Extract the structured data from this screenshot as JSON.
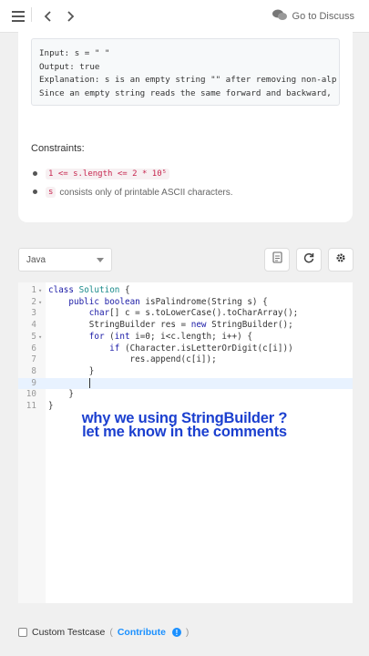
{
  "header": {
    "discuss_label": "Go to Discuss"
  },
  "description": {
    "example_lines": [
      "Input: s = \" \"",
      "Output: true",
      "Explanation: s is an empty string \"\" after removing non-alp",
      "Since an empty string reads the same forward and backward,"
    ],
    "constraints_title": "Constraints:",
    "constraints": [
      {
        "code": "1 <= s.length <= 2 * 10⁵",
        "text": ""
      },
      {
        "code": "s",
        "text": "consists only of printable ASCII characters."
      }
    ]
  },
  "editor": {
    "language": "Java",
    "lines": [
      {
        "num": "1",
        "fold": true,
        "text": "class Solution {"
      },
      {
        "num": "2",
        "fold": true,
        "text": "    public boolean isPalindrome(String s) {"
      },
      {
        "num": "3",
        "fold": false,
        "text": "        char[] c = s.toLowerCase().toCharArray();"
      },
      {
        "num": "4",
        "fold": false,
        "text": "        StringBuilder res = new StringBuilder();"
      },
      {
        "num": "5",
        "fold": true,
        "text": "        for (int i=0; i<c.length; i++) {"
      },
      {
        "num": "6",
        "fold": false,
        "text": "            if (Character.isLetterOrDigit(c[i]))"
      },
      {
        "num": "7",
        "fold": false,
        "text": "                res.append(c[i]);"
      },
      {
        "num": "8",
        "fold": false,
        "text": "        }"
      },
      {
        "num": "9",
        "fold": false,
        "text": "        "
      },
      {
        "num": "10",
        "fold": false,
        "text": "    }"
      },
      {
        "num": "11",
        "fold": false,
        "text": "}"
      }
    ],
    "active_line": 9
  },
  "overlay": {
    "line1": "why we using StringBuilder ?",
    "line2": "let me know in the comments"
  },
  "footer": {
    "custom_testcase_label": "Custom Testcase",
    "open_paren": "(",
    "contribute_label": "Contribute",
    "close_paren": ")"
  },
  "colors": {
    "accent": "#1a90ff",
    "caption": "#1b3fcf",
    "keyword": "#1a1aa6",
    "code_chip": "#c7254e"
  }
}
